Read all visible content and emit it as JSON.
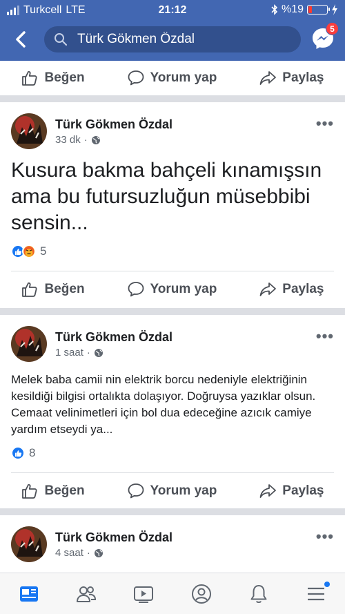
{
  "status_bar": {
    "carrier": "Turkcell",
    "network": "LTE",
    "time": "21:12",
    "battery": "%19"
  },
  "search": {
    "value": "Türk Gökmen Özdal"
  },
  "messenger": {
    "badge": "5"
  },
  "actions": {
    "like": "Beğen",
    "comment": "Yorum yap",
    "share": "Paylaş"
  },
  "posts": [
    {
      "author": "Türk Gökmen Özdal",
      "time": "33 dk",
      "separator": "·",
      "text": "Kusura bakma bahçeli kınamışsın ama bu futursuzluğun müsebbibi sensin...",
      "reactions_count": "5"
    },
    {
      "author": "Türk Gökmen Özdal",
      "time": "1 saat",
      "separator": "·",
      "text": "Melek baba camii nin elektrik borcu nedeniyle elektriğinin kesildiği bilgisi ortalıkta dolaşıyor. Doğruysa yazıklar olsun. Cemaat velinimetleri için bol dua edeceğine azıcık camiye yardım etseydi ya...",
      "reactions_count": "8"
    },
    {
      "author": "Türk Gökmen Özdal",
      "time": "4 saat",
      "separator": "·"
    }
  ],
  "colors": {
    "brand": "#4267b2",
    "like": "#1877f2",
    "angry": "#f7b125",
    "badge": "#fa3e3e"
  }
}
